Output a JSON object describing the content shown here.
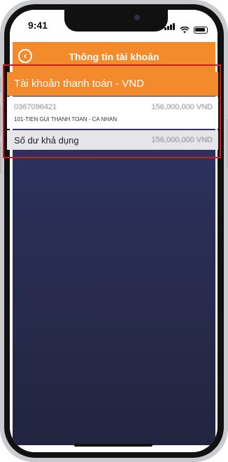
{
  "status_bar": {
    "time": "9:41"
  },
  "header": {
    "title": "Thông tin tài khoản",
    "back_icon": "back-chevron-icon"
  },
  "account_card": {
    "title": "Tài khoản thanh toán - VND",
    "account_number": "0367096421",
    "account_balance": "156,000,000 VND",
    "account_type": "101-TIEN GUI THANH TOAN - CA NHAN",
    "available_label": "Số dư khả dụng",
    "available_balance": "156,000,000 VND"
  },
  "colors": {
    "accent": "#f38a2c",
    "highlight": "#c81e1e",
    "background": "#2a2e55"
  }
}
